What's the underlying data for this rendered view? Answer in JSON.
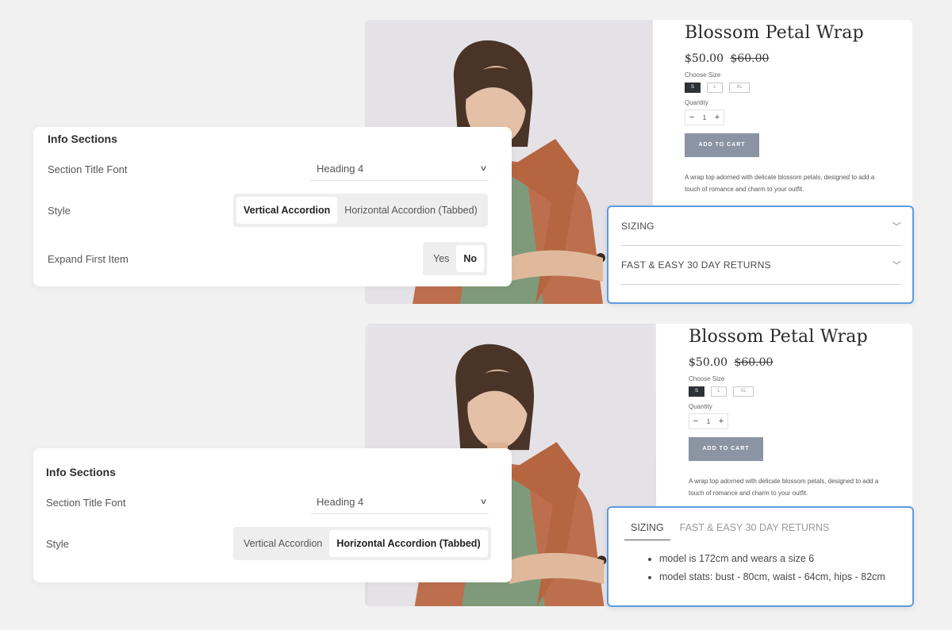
{
  "product": {
    "title": "Blossom Petal Wrap",
    "price": "$50.00",
    "compare_price": "$60.00",
    "size_label": "Choose Size",
    "sizes": [
      "S",
      "L",
      "XL"
    ],
    "selected_size": "S",
    "quantity_label": "Quantity",
    "quantity": "1",
    "minus": "−",
    "plus": "+",
    "add_to_cart": "ADD TO CART",
    "description": "A wrap top adorned with delicate blossom petals, designed to add a touch of romance and charm to your outfit."
  },
  "accordion_vertical": {
    "items": [
      "SIZING",
      "FAST & EASY 30 DAY RETURNS"
    ],
    "chevron": "⌄"
  },
  "accordion_horizontal": {
    "tabs": [
      "SIZING",
      "FAST & EASY 30 DAY RETURNS"
    ],
    "active_tab": "SIZING",
    "content": [
      "model is 172cm and wears a size 6",
      "model stats: bust - 80cm, waist - 64cm, hips - 82cm"
    ]
  },
  "settings_top": {
    "title": "Info Sections",
    "font_label": "Section Title Font",
    "font_value": "Heading 4",
    "style_label": "Style",
    "style_options": [
      "Vertical Accordion",
      "Horizontal Accordion (Tabbed)"
    ],
    "style_selected": "Vertical Accordion",
    "expand_label": "Expand First Item",
    "expand_options": [
      "Yes",
      "No"
    ],
    "expand_selected": "No"
  },
  "settings_bottom": {
    "title": "Info Sections",
    "font_label": "Section Title Font",
    "font_value": "Heading 4",
    "style_label": "Style",
    "style_options": [
      "Vertical Accordion",
      "Horizontal Accordion (Tabbed)"
    ],
    "style_selected": "Horizontal Accordion (Tabbed)"
  },
  "icons": {
    "select_chevron": "chevron-down-icon"
  }
}
